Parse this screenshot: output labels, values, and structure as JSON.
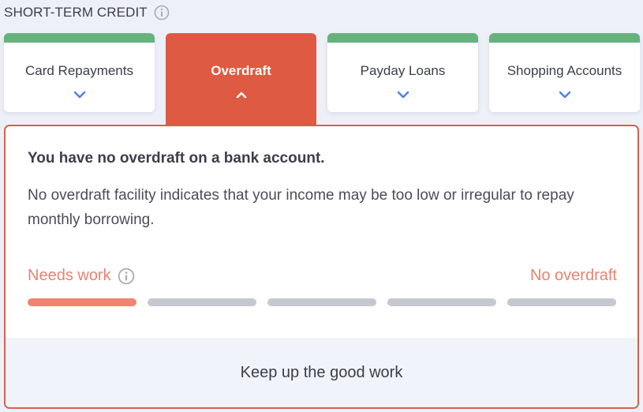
{
  "header": {
    "title": "SHORT-TERM CREDIT",
    "info_icon": "info-icon"
  },
  "tabs": [
    {
      "label": "Card Repayments",
      "active": false,
      "icon": "chevron-down-icon"
    },
    {
      "label": "Overdraft",
      "active": true,
      "icon": "chevron-up-icon"
    },
    {
      "label": "Payday Loans",
      "active": false,
      "icon": "chevron-down-icon"
    },
    {
      "label": "Shopping Accounts",
      "active": false,
      "icon": "chevron-down-icon"
    }
  ],
  "panel": {
    "heading": "You have no overdraft on a bank account.",
    "description": "No overdraft facility indicates that your income may be too low or irregular to repay monthly borrowing.",
    "status_label": "Needs work",
    "status_value": "No overdraft",
    "rating": {
      "level": 1,
      "max": 5
    },
    "footer": "Keep up the good work"
  },
  "colors": {
    "accent": "#df5a42",
    "tab_bar": "#66b27d",
    "chevron": "#4f86e0",
    "status": "#ea8270",
    "segment_filled": "#ef8471",
    "segment_empty": "#c5c8cf"
  }
}
